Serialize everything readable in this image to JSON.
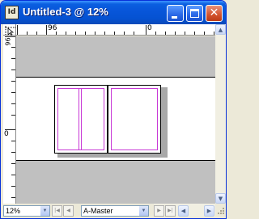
{
  "window": {
    "app_icon_text": "Id",
    "title": "Untitled-3 @ 12%",
    "minimize_label": "minimize",
    "maximize_label": "maximize",
    "close_glyph": "✕"
  },
  "ruler": {
    "horizontal_labels": [
      "96",
      "0"
    ],
    "vertical_labels": [
      "96",
      "0"
    ]
  },
  "status": {
    "zoom_value": "12%",
    "master_value": "A-Master",
    "first_page_glyph": "|◀",
    "prev_page_glyph": "◀",
    "next_page_glyph": "▶",
    "last_page_glyph": "▶|",
    "dropdown_glyph": "▼"
  },
  "scroll": {
    "up_glyph": "▲",
    "down_glyph": "▼",
    "left_glyph": "◀",
    "right_glyph": "▶"
  },
  "colors": {
    "titlebar": "#0856DA",
    "pasteboard": "#C0C0C0",
    "guides": "#C839D6"
  }
}
